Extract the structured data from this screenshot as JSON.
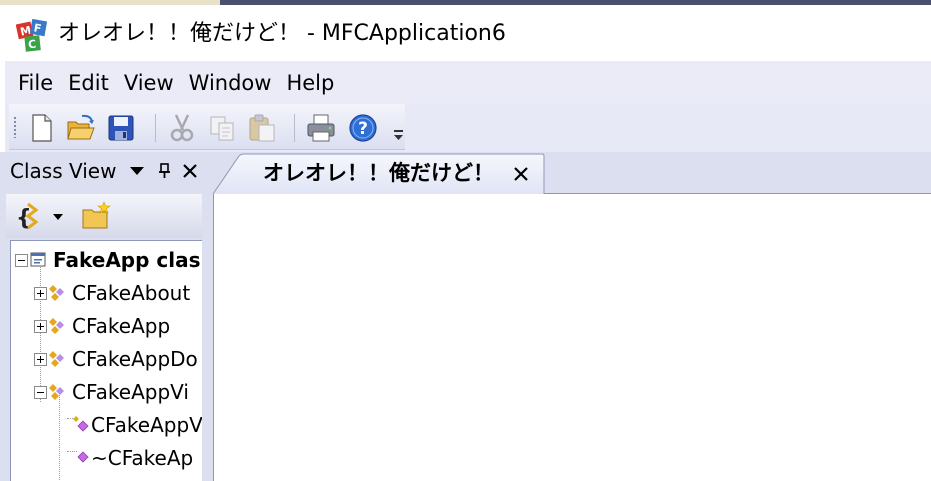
{
  "window": {
    "title": "オレオレ！！俺だけど！ - MFCApplication6"
  },
  "menu": [
    {
      "label": "File"
    },
    {
      "label": "Edit"
    },
    {
      "label": "View"
    },
    {
      "label": "Window"
    },
    {
      "label": "Help"
    }
  ],
  "toolbar": {
    "buttons": [
      {
        "icon": "new-file-icon",
        "enabled": true
      },
      {
        "icon": "open-folder-icon",
        "enabled": true
      },
      {
        "icon": "save-disk-icon",
        "enabled": true
      },
      {
        "icon": "cut-scissors-icon",
        "enabled": false
      },
      {
        "icon": "copy-icon",
        "enabled": false
      },
      {
        "icon": "paste-clipboard-icon",
        "enabled": false
      },
      {
        "icon": "printer-icon",
        "enabled": true
      },
      {
        "icon": "help-question-icon",
        "enabled": true
      }
    ]
  },
  "class_view": {
    "title": "Class View",
    "tree": [
      {
        "label": "FakeApp clas",
        "bold": true,
        "expanded": true,
        "icon": "project-icon"
      },
      {
        "label": "CFakeAbout",
        "expanded": false,
        "icon": "class-icon"
      },
      {
        "label": "CFakeApp",
        "expanded": false,
        "icon": "class-icon"
      },
      {
        "label": "CFakeAppDo",
        "expanded": false,
        "icon": "class-icon"
      },
      {
        "label": "CFakeAppVi",
        "expanded": true,
        "icon": "class-icon"
      },
      {
        "label": "CFakeAppV",
        "icon": "method-icon"
      },
      {
        "label": "~CFakeAp",
        "icon": "method-icon"
      }
    ]
  },
  "document_tab": {
    "label": "オレオレ！！俺だけど！"
  },
  "colors": {
    "menu_bg": "#ebebf8",
    "pane_bg": "#dcdfef",
    "border": "#8f97b8"
  }
}
